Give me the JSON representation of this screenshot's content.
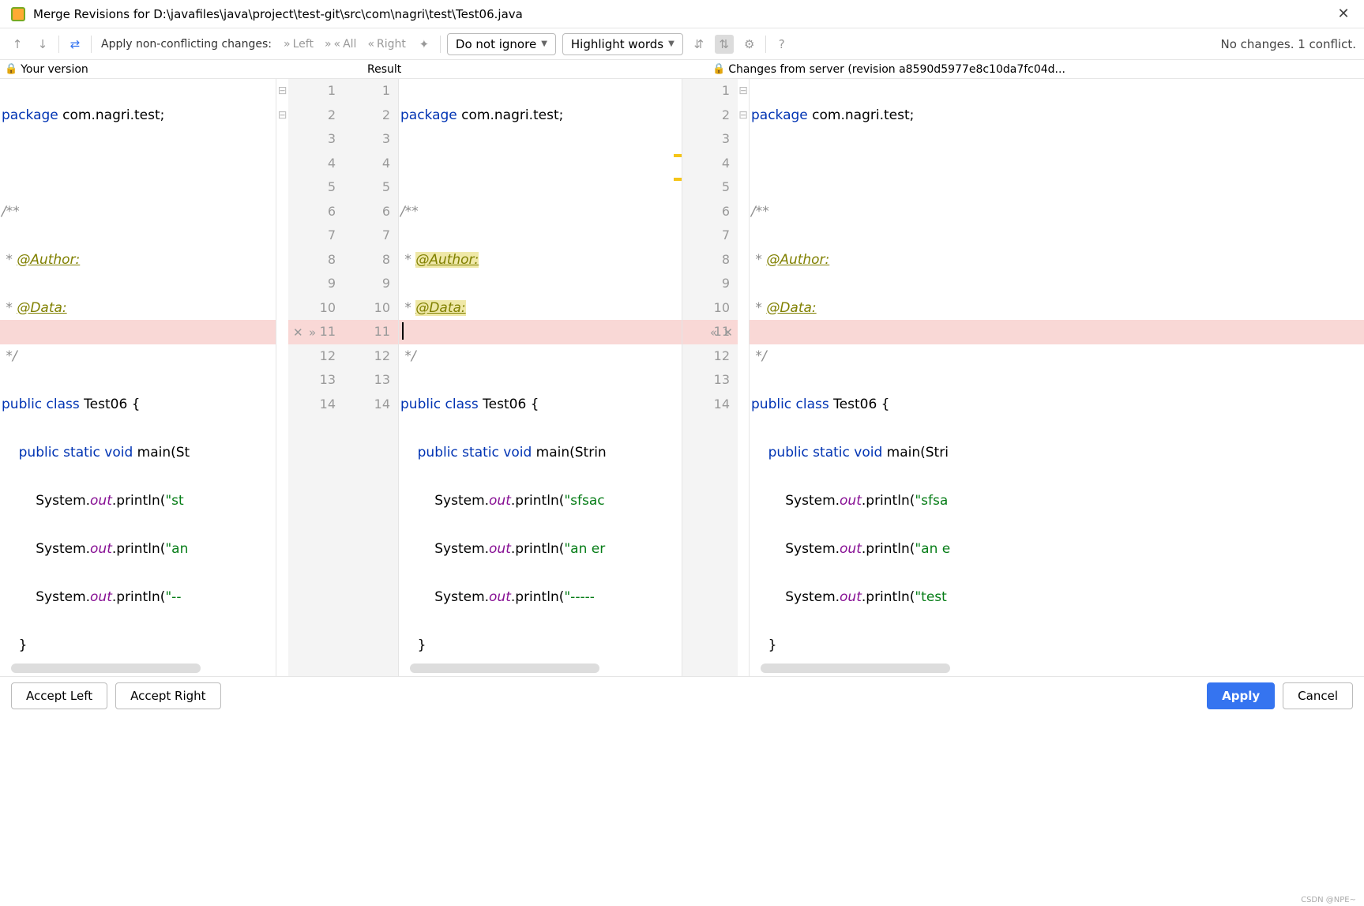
{
  "title": "Merge Revisions for D:\\javafiles\\java\\project\\test-git\\src\\com\\nagri\\test\\Test06.java",
  "toolbar": {
    "apply_label": "Apply non-conflicting changes:",
    "left": "Left",
    "all": "All",
    "right": "Right",
    "ignore_dd": "Do not ignore",
    "highlight_dd": "Highlight words",
    "status": "No changes. 1 conflict."
  },
  "panels": {
    "left": "Your version",
    "mid": "Result",
    "right": "Changes from server (revision a8590d5977e8c10da7fc04d..."
  },
  "lines": {
    "left": [
      "1",
      "2",
      "3",
      "4",
      "5",
      "6",
      "7",
      "8",
      "9",
      "10",
      "11",
      "12",
      "13",
      "14"
    ],
    "mid": [
      "1",
      "2",
      "3",
      "4",
      "5",
      "6",
      "7",
      "8",
      "9",
      "10",
      "11",
      "12",
      "13",
      "14"
    ],
    "right": [
      "1",
      "2",
      "3",
      "4",
      "5",
      "6",
      "7",
      "8",
      "9",
      "10",
      "11",
      "12",
      "13",
      "14"
    ]
  },
  "code": {
    "conflict_line": 11,
    "left": {
      "pkg": "package com.nagri.test;",
      "c1": "/**",
      "c2": " * @Author:",
      "c3": " * @Data:",
      "c4": " */",
      "cls": "public class Test06 {",
      "main": "    public static void main(St",
      "l9": "        System.out.println(\"st",
      "l10": "        System.out.println(\"an",
      "l11": "        System.out.println(\"--",
      "l12": "    }",
      "l13": "}"
    },
    "mid": {
      "pkg": "package com.nagri.test;",
      "c1": "/**",
      "c2": " * @Author:",
      "c3": " * @Data:",
      "c4": " */",
      "cls": "public class Test06 {",
      "main": "    public static void main(Strin",
      "l9": "        System.out.println(\"sfsac",
      "l10": "        System.out.println(\"an er",
      "l11": "        System.out.println(\"-----",
      "l12": "    }",
      "l13": "}"
    },
    "right": {
      "pkg": "package com.nagri.test;",
      "c1": "/**",
      "c2": " * @Author:",
      "c3": " * @Data:",
      "c4": " */",
      "cls": "public class Test06 {",
      "main": "    public static void main(Stri",
      "l9": "        System.out.println(\"sfsa",
      "l10": "        System.out.println(\"an e",
      "l11": "        System.out.println(\"test",
      "l12": "    }",
      "l13": "}"
    }
  },
  "footer": {
    "accept_left": "Accept Left",
    "accept_right": "Accept Right",
    "apply": "Apply",
    "cancel": "Cancel"
  },
  "watermark": "CSDN @NPE~"
}
